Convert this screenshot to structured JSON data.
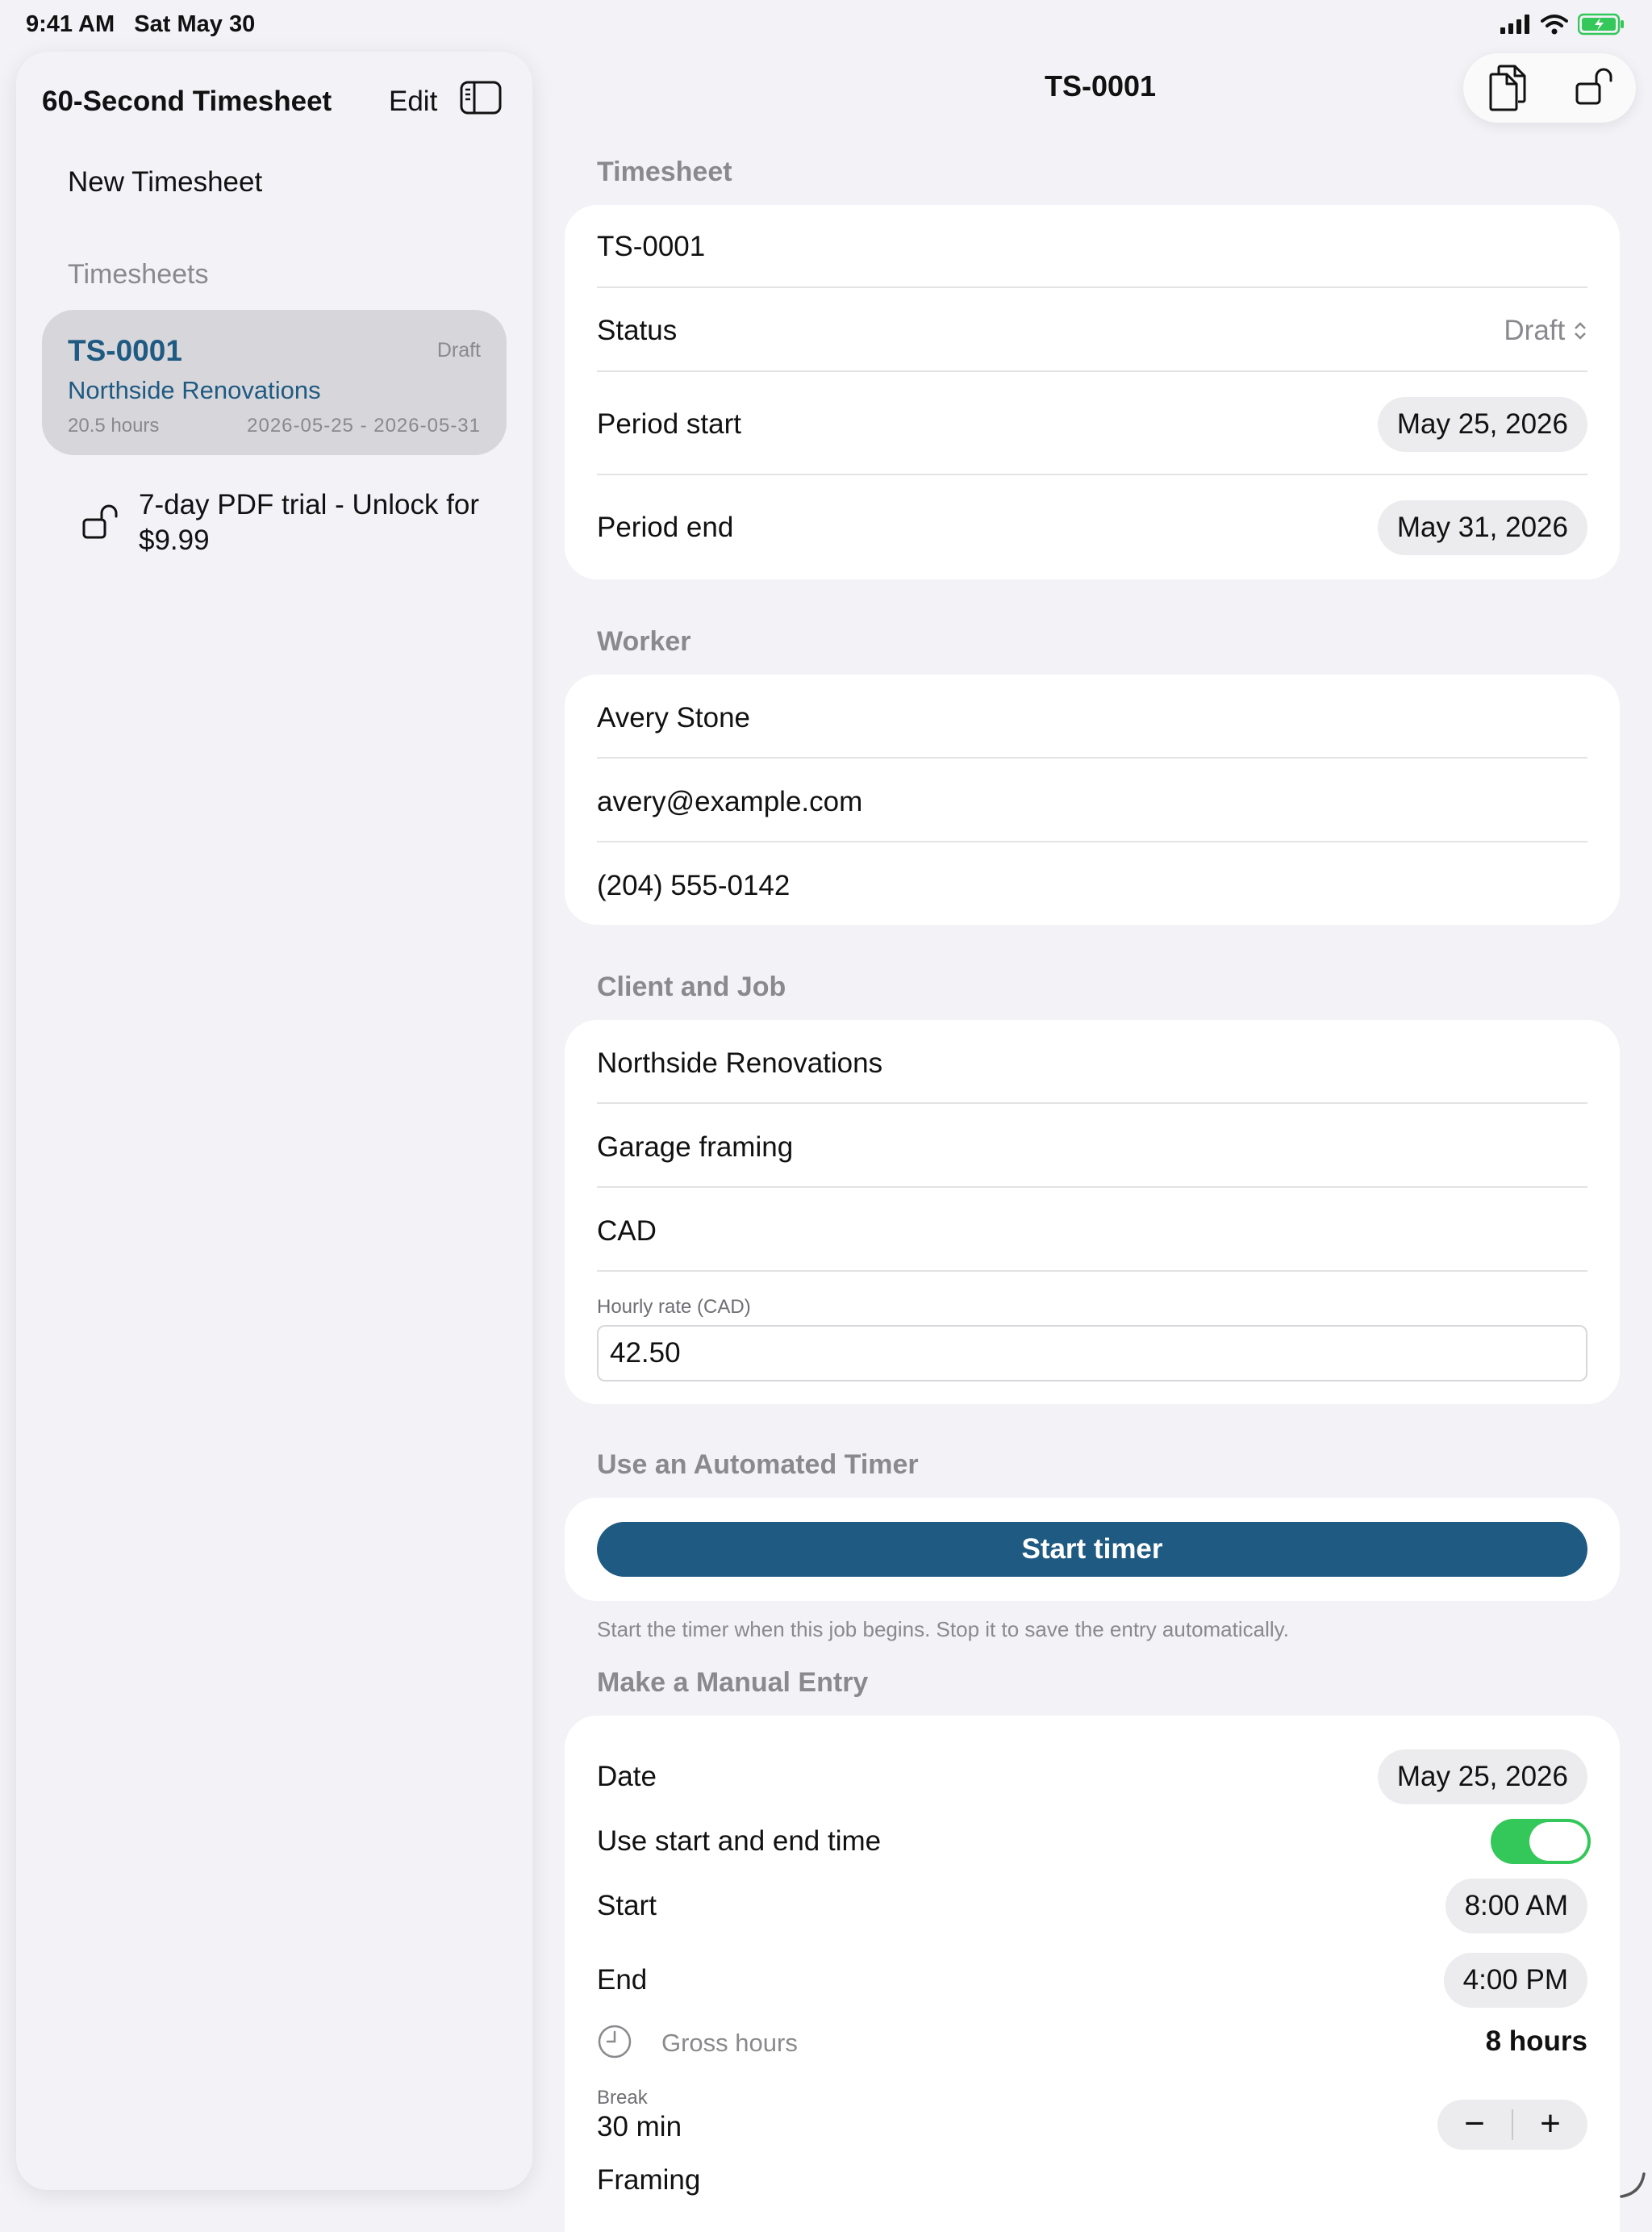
{
  "status_bar": {
    "time": "9:41 AM",
    "date": "Sat May 30"
  },
  "sidebar": {
    "title": "60-Second Timesheet",
    "edit_label": "Edit",
    "new_timesheet_label": "New Timesheet",
    "section_label": "Timesheets",
    "timesheets": [
      {
        "id": "TS-0001",
        "status": "Draft",
        "client": "Northside Renovations",
        "hours": "20.5 hours",
        "range": "2026-05-25 - 2026-05-31"
      }
    ],
    "trial_label": "7-day PDF trial - Unlock for $9.99"
  },
  "main": {
    "title": "TS-0001",
    "timesheet": {
      "label": "Timesheet",
      "number": "TS-0001",
      "status_label": "Status",
      "status_value": "Draft",
      "period_start_label": "Period start",
      "period_start_value": "May 25, 2026",
      "period_end_label": "Period end",
      "period_end_value": "May 31, 2026"
    },
    "worker": {
      "label": "Worker",
      "name": "Avery Stone",
      "email": "avery@example.com",
      "phone": "(204) 555-0142"
    },
    "client_job": {
      "label": "Client and Job",
      "client": "Northside Renovations",
      "job": "Garage framing",
      "currency": "CAD",
      "rate_label": "Hourly rate (CAD)",
      "rate_value": "42.50"
    },
    "timer": {
      "label": "Use an Automated Timer",
      "button": "Start timer",
      "helper": "Start the timer when this job begins. Stop it to save the entry automatically."
    },
    "manual": {
      "label": "Make a Manual Entry",
      "date_label": "Date",
      "date_value": "May 25, 2026",
      "use_times_label": "Use start and end time",
      "use_times_on": true,
      "start_label": "Start",
      "start_value": "8:00 AM",
      "end_label": "End",
      "end_value": "4:00 PM",
      "gross_label": "Gross hours",
      "gross_value": "8 hours",
      "break_label": "Break",
      "break_value": "30 min",
      "minus_label": "−",
      "plus_label": "+",
      "task_value": "Framing"
    }
  },
  "colors": {
    "accent": "#1f5a82",
    "toggle_on": "#34c759",
    "background": "#f2f2f7"
  },
  "icons": [
    "signal-icon",
    "wifi-icon",
    "battery-icon",
    "sidebar-toggle-icon",
    "unlock-icon",
    "copy-icon",
    "clock-icon"
  ]
}
